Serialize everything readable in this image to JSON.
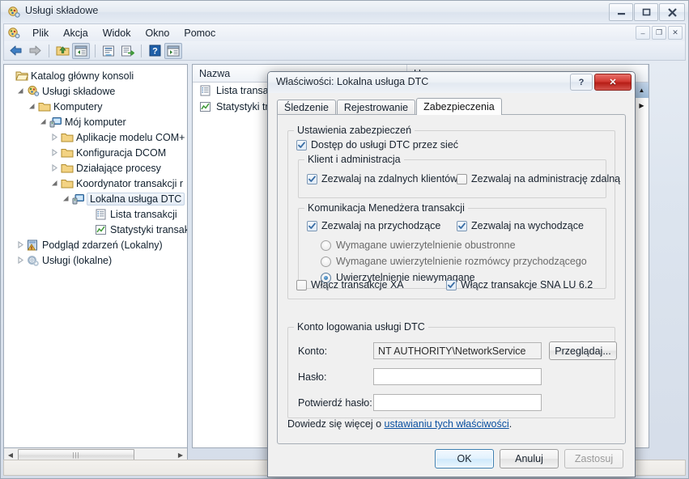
{
  "window": {
    "title": "Usługi składowe",
    "icon": "component-services-icon",
    "controls": {
      "minimize": "minimize-icon",
      "maximize": "maximize-icon",
      "close": "close-icon"
    },
    "menu": [
      "Plik",
      "Akcja",
      "Widok",
      "Okno",
      "Pomoc"
    ],
    "mdi_controls": {
      "minimize": "–",
      "restore": "❐",
      "close": "✕"
    },
    "toolbar": [
      {
        "name": "back-icon",
        "label": "Wstecz"
      },
      {
        "name": "forward-icon",
        "label": "Dalej"
      },
      {
        "name": "up-folder-icon",
        "label": "W górę"
      },
      {
        "name": "show-hide-tree-icon",
        "label": "Pokaż/ukryj drzewo"
      },
      {
        "name": "properties-icon",
        "label": "Właściwości"
      },
      {
        "name": "export-list-icon",
        "label": "Eksportuj listę"
      },
      {
        "name": "help-icon",
        "label": "Pomoc"
      },
      {
        "name": "console-view-icon",
        "label": "Widok konsoli"
      }
    ]
  },
  "tree": {
    "nodes": [
      {
        "label": "Katalog główny konsoli",
        "indent": 0,
        "twist": "none",
        "icon": "folder-open-icon",
        "selected": false
      },
      {
        "label": "Usługi składowe",
        "indent": 1,
        "twist": "expanded",
        "icon": "component-services-icon",
        "selected": false
      },
      {
        "label": "Komputery",
        "indent": 2,
        "twist": "expanded",
        "icon": "folder-icon",
        "selected": false
      },
      {
        "label": "Mój komputer",
        "indent": 3,
        "twist": "expanded",
        "icon": "computer-icon",
        "selected": false
      },
      {
        "label": "Aplikacje modelu COM+",
        "indent": 4,
        "twist": "collapsed",
        "icon": "folder-icon",
        "selected": false
      },
      {
        "label": "Konfiguracja DCOM",
        "indent": 4,
        "twist": "collapsed",
        "icon": "folder-icon",
        "selected": false
      },
      {
        "label": "Działające procesy",
        "indent": 4,
        "twist": "collapsed",
        "icon": "folder-icon",
        "selected": false
      },
      {
        "label": "Koordynator transakcji r",
        "indent": 4,
        "twist": "expanded",
        "icon": "folder-icon",
        "selected": false
      },
      {
        "label": "Lokalna usługa DTC",
        "indent": 5,
        "twist": "expanded",
        "icon": "computer-icon",
        "selected": true
      },
      {
        "label": "Lista transakcji",
        "indent": 6,
        "twist": "none",
        "icon": "transaction-list-icon",
        "selected": false
      },
      {
        "label": "Statystyki transak",
        "indent": 6,
        "twist": "none",
        "icon": "statistics-icon",
        "selected": false
      },
      {
        "label": "Podgląd zdarzeń (Lokalny)",
        "indent": 1,
        "twist": "collapsed",
        "icon": "event-viewer-icon",
        "selected": false
      },
      {
        "label": "Usługi (lokalne)",
        "indent": 1,
        "twist": "collapsed",
        "icon": "services-icon",
        "selected": false
      }
    ]
  },
  "list": {
    "columns": [
      "Nazwa",
      "Ho"
    ],
    "rows": [
      {
        "name": "Lista transak",
        "icon": "transaction-list-icon"
      },
      {
        "name": "Statystyki tra",
        "icon": "statistics-icon"
      }
    ]
  },
  "dialog": {
    "title": "Właściwości: Lokalna usługa DTC",
    "help_button": "?",
    "close_button": "✕",
    "tabs": [
      {
        "label": "Śledzenie",
        "active": false
      },
      {
        "label": "Rejestrowanie",
        "active": false
      },
      {
        "label": "Zabezpieczenia",
        "active": true
      }
    ],
    "security_group": {
      "title": "Ustawienia zabezpieczeń",
      "network_access": {
        "label": "Dostęp do usługi DTC przez sieć",
        "checked": true
      },
      "client_group": {
        "title": "Klient i administracja",
        "allow_remote_clients": {
          "label": "Zezwalaj na zdalnych klientów",
          "checked": true
        },
        "allow_remote_admin": {
          "label": "Zezwalaj na administrację zdalną",
          "checked": false
        }
      },
      "tm_group": {
        "title": "Komunikacja Menedżera transakcji",
        "allow_inbound": {
          "label": "Zezwalaj na przychodzące",
          "checked": true
        },
        "allow_outbound": {
          "label": "Zezwalaj na wychodzące",
          "checked": true
        },
        "auth_options": [
          {
            "label": "Wymagane uwierzytelnienie obustronne",
            "selected": false,
            "enabled": false
          },
          {
            "label": "Wymagane uwierzytelnienie rozmówcy przychodzącego",
            "selected": false,
            "enabled": false
          },
          {
            "label": "Uwierzytelnienie niewymagane",
            "selected": true,
            "enabled": true
          }
        ]
      },
      "enable_xa": {
        "label": "Włącz transakcje XA",
        "checked": false
      },
      "enable_sna": {
        "label": "Włącz transakcje SNA LU 6.2",
        "checked": true
      }
    },
    "account_group": {
      "title": "Konto logowania usługi DTC",
      "account_label": "Konto:",
      "account_value": "NT AUTHORITY\\NetworkService",
      "browse_button": "Przeglądaj...",
      "password_label": "Hasło:",
      "password_value": "",
      "confirm_label": "Potwierdź hasło:",
      "confirm_value": ""
    },
    "learn_more": {
      "prefix": "Dowiedz się więcej o ",
      "link": "ustawianiu tych właściwości",
      "suffix": "."
    },
    "buttons": {
      "ok": "OK",
      "cancel": "Anuluj",
      "apply": "Zastosuj"
    }
  },
  "colors": {
    "accent": "#3c7fb1",
    "close_red": "#c2261d",
    "link": "#0a50a0",
    "selection": "#a9c6e2"
  }
}
